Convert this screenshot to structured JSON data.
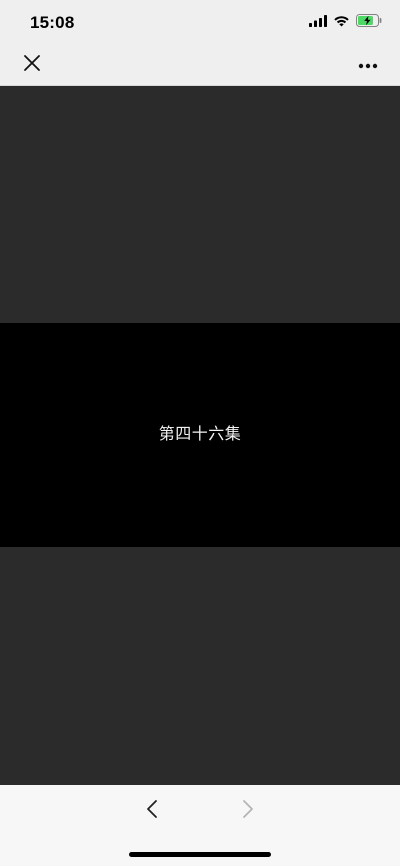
{
  "status_bar": {
    "time": "15:08",
    "icons": [
      "cellular-signal-icon",
      "wifi-icon",
      "battery-charging-icon"
    ]
  },
  "nav_bar": {
    "left_icon": "close-icon",
    "right_icon": "more-icon"
  },
  "content": {
    "episode_title": "第四十六集"
  },
  "toolbar": {
    "back_icon": "chevron-left-icon",
    "forward_icon": "chevron-right-icon",
    "forward_enabled": false
  },
  "colors": {
    "bars_bg": "#efefef",
    "page_bg": "#2b2b2b",
    "banner_bg": "#000000",
    "battery_fill": "#4cd964"
  }
}
